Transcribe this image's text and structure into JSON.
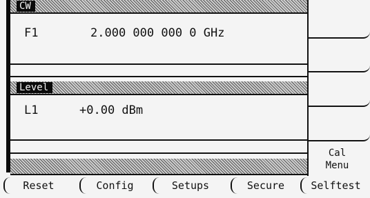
{
  "cw_panel": {
    "title": "CW",
    "freq_label": "F1",
    "freq_value": "2.000 000 000 0 GHz"
  },
  "level_panel": {
    "title": "Level",
    "level_label": "L1",
    "level_value": "+0.00 dBm"
  },
  "softkeys": {
    "key1": "",
    "key2": "",
    "key3": "",
    "key4": "",
    "key5_line1": "Cal",
    "key5_line2": "Menu"
  },
  "bottom_menu": {
    "reset": "Reset",
    "config": "Config",
    "setups": "Setups",
    "secure": "Secure",
    "selftest": "Selftest"
  },
  "colors": {
    "background": "#f4f4f4",
    "foreground": "#111111",
    "hatch": "#9a9a9a"
  }
}
